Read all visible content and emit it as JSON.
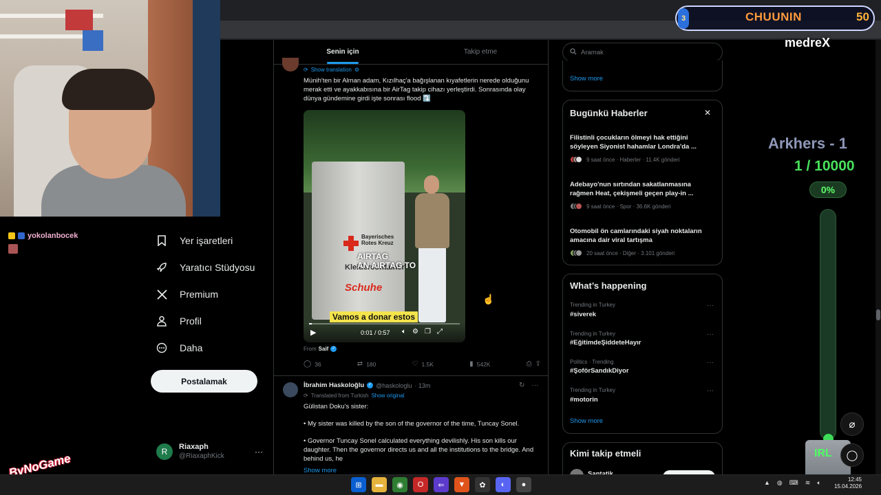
{
  "nav": {
    "items": [
      {
        "label": "Yer işaretleri",
        "icon": "bookmark-icon"
      },
      {
        "label": "Yaratıcı Stüdyosu",
        "icon": "rocket-icon"
      },
      {
        "label": "Premium",
        "icon": "x-logo-icon"
      },
      {
        "label": "Profil",
        "icon": "person-icon"
      },
      {
        "label": "Daha",
        "icon": "more-circle-icon"
      }
    ],
    "post_button": "Postalamak",
    "account": {
      "name": "Riaxaph",
      "handle": "@RiaxaphKick",
      "initial": "R",
      "more": "···"
    }
  },
  "timeline": {
    "tabs": [
      "Senin için",
      "Takip etme"
    ],
    "tweet1": {
      "show_translation": "Show translation",
      "text": "Münih'ten bir Alman adam, Kızılhaç'a bağışlanan kıyafetlerin nerede olduğunu merak etti ve ayakkabısına bir AirTag takip cihazı yerleştirdi. Sonrasında olay dünya gündemine girdi işte sonrası flood ⤵️",
      "video": {
        "sign_top": "Bayerisches Rotes Kreuz",
        "sign_mid": "Kleidercontainer",
        "sign_brand": "Schuhe",
        "overlay": "AIRTAG\nAN AIRTAG TO",
        "caption": "Vamos a donar estos",
        "time": "0:01 / 0:57",
        "progress": 0.02
      },
      "from_label": "From",
      "from_name": "Saif",
      "stats": {
        "replies": "36",
        "reposts": "180",
        "likes": "1.5K",
        "views": "542K"
      }
    },
    "tweet2": {
      "name": "İbrahim Haskoloğlu",
      "handle": "@haskologlu",
      "time": "· 13m",
      "translated": "Translated from Turkish",
      "show_original": "Show original",
      "line1": "Gülistan Doku's sister:",
      "line2": "• My sister was killed by the son of the governor of the time, Tuncay Sonel.",
      "line3": "• Governor Tuncay Sonel calculated everything devilishly. His son kills our daughter. Then the governor directs us and all the institutions to the bridge. And behind us, he",
      "show_more": "Show more"
    }
  },
  "sidebar": {
    "search_placeholder": "Aramak",
    "top_show_more": "Show more",
    "news": {
      "title": "Bugünkü Haberler",
      "items": [
        {
          "title": "Filistinli çocukların ölmeyi hak ettiğini söyleyen Siyonist hahamlar Londra'da ...",
          "meta": "9 saat önce · Haberler · 11.4K gönderi"
        },
        {
          "title": "Adebayo'nun sırtından sakatlanmasına rağmen Heat, çekişmeli geçen play-in ...",
          "meta": "9 saat önce · Spor · 36.6K gönderi"
        },
        {
          "title": "Otomobil ön camlarındaki siyah noktaların amacına dair viral tartışma",
          "meta": "20 saat önce · Diğer · 3.101 gönderi"
        }
      ]
    },
    "happening": {
      "title": "What’s happening",
      "trends": [
        {
          "category": "Trending in Turkey",
          "tag": "#siverek"
        },
        {
          "category": "Trending in Turkey",
          "tag": "#EğitimdeŞiddeteHayır"
        },
        {
          "category": "Politics · Trending",
          "tag": "#ŞoförSandıkDiyor"
        },
        {
          "category": "Trending in Turkey",
          "tag": "#motorin"
        }
      ],
      "show_more": "Show more"
    },
    "follow_title": "Kimi takip etmeli",
    "follow_first": "Santatik"
  },
  "overlay": {
    "chat_user": "yokolanbocek",
    "chuunin_level": "3",
    "chuunin_name": "CHUUNIN",
    "chuunin_value": "50",
    "medrex": "medreX",
    "goal_name": "Arkhers - 1",
    "goal_progress": "1 / 10000",
    "goal_percent": "0%",
    "goal_fraction": 0.0001,
    "irl": "IRL",
    "logo": "ByNoGame"
  },
  "taskbar": {
    "time": "12:45",
    "date": "15.04.2026"
  },
  "colors": {
    "accent": "#1d9bf0",
    "bg": "#000000",
    "border": "#2f3336",
    "muted": "#71767b",
    "goal_green": "#49e05c",
    "chuunin_orange": "#ff9a3c"
  }
}
